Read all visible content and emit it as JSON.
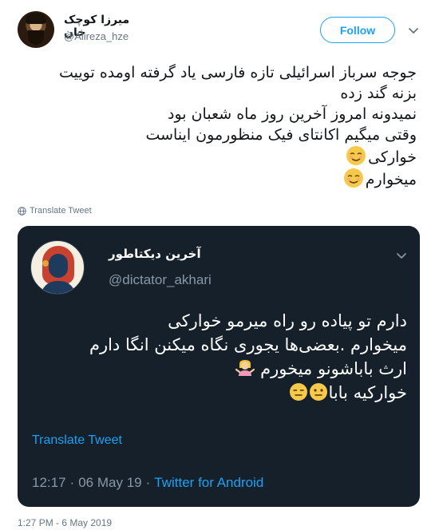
{
  "tweet": {
    "author": {
      "display_name": "میرزا کوچک خان",
      "handle": "@Alireza_hze"
    },
    "follow_label": "Follow",
    "text_lines": [
      "جوجه سرباز اسرائیلی تازه فارسی یاد گرفته اومده توییت",
      "بزنه گند زده",
      "نمیدونه امروز آخرین روز ماه شعبان بود",
      "وقتی میگیم اکانتای فیک منظورمون ایناست",
      "خوارکی",
      "میخوارم"
    ],
    "translate_label": "Translate Tweet",
    "timestamp": "1:27 PM - 6 May 2019"
  },
  "quoted": {
    "author": {
      "display_name": "آخرین دیکتاطور",
      "handle": "@dictator_akhari"
    },
    "text_lines": [
      "دارم تو پیاده رو راه میرمو خوارکی",
      "میخوارم .بعضی‌ها یجوری نگاه میکنن انگا دارم",
      "ارث باباشونو میخورم",
      "خوارکیه بابا"
    ],
    "translate_label": "Translate Tweet",
    "time": "12:17",
    "date": "06 May 19",
    "source": "Twitter for Android"
  },
  "colors": {
    "accent": "#1da1f2",
    "card_bg": "#15202b",
    "muted": "#657786"
  },
  "icons": {
    "main_emoji": "relieved-face-emoji",
    "shrug": "woman-shrugging-emoji",
    "neutral": "neutral-face-emoji",
    "expressionless": "expressionless-face-emoji"
  }
}
